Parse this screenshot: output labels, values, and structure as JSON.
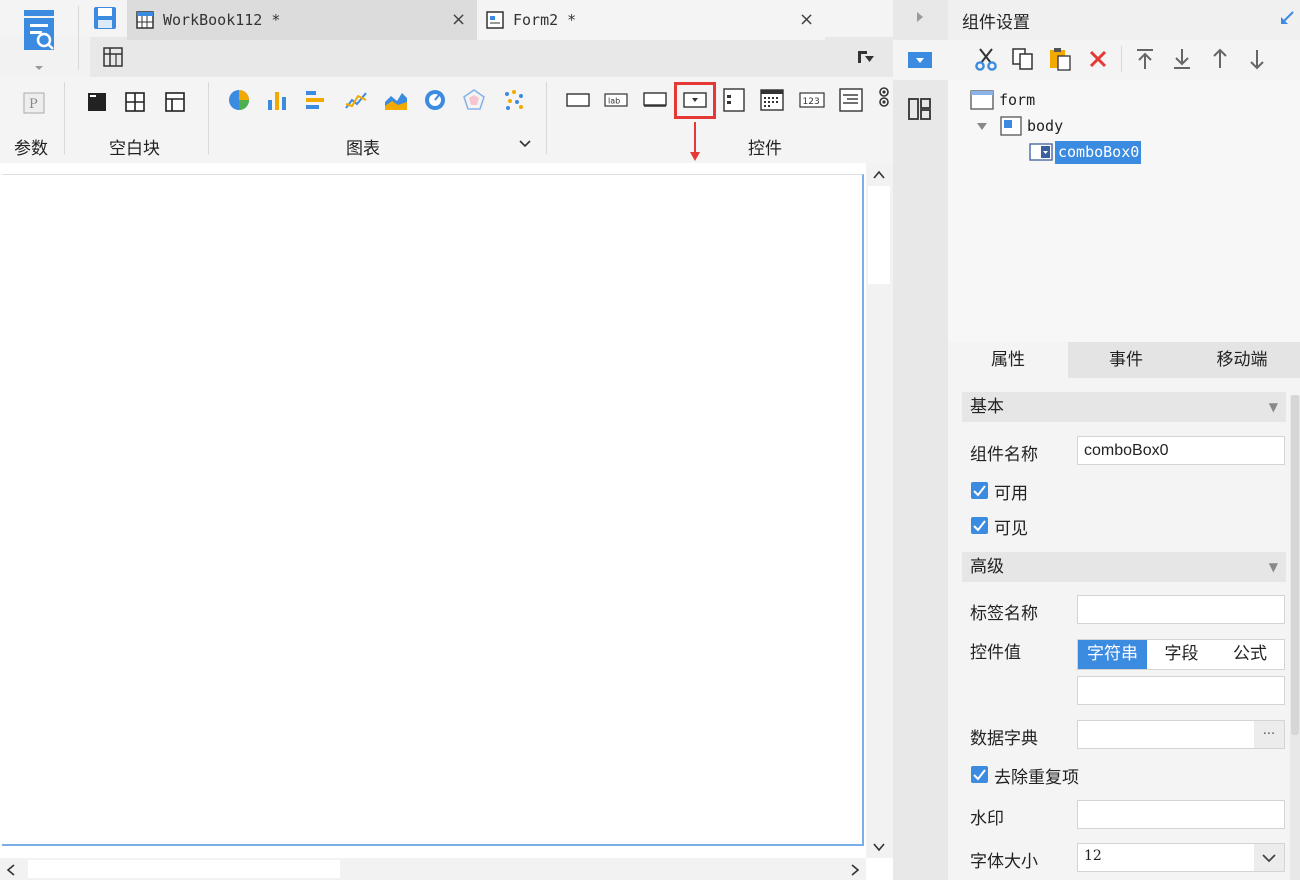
{
  "tabs": [
    {
      "label": "WorkBook112 *",
      "close": "×",
      "icon": "workbook-grid-icon"
    },
    {
      "label": "Form2 *",
      "close": "×",
      "icon": "form-icon"
    }
  ],
  "ribbon": {
    "param_label": "参数",
    "blank_label": "空白块",
    "chart_label": "图表",
    "widget_label": "控件"
  },
  "panel": {
    "title": "组件设置",
    "tree": {
      "form": "form",
      "body": "body",
      "combo": "comboBox0"
    },
    "tabs": [
      "属性",
      "事件",
      "移动端"
    ],
    "sections": {
      "basic": "基本",
      "advanced": "高级"
    },
    "props": {
      "name_label": "组件名称",
      "name_value": "comboBox0",
      "enabled_label": "可用",
      "visible_label": "可见",
      "tag_label": "标签名称",
      "tag_value": "",
      "value_label": "控件值",
      "value_modes": [
        "字符串",
        "字段",
        "公式"
      ],
      "value_text": "",
      "dict_label": "数据字典",
      "dict_btn": "···",
      "dedupe_label": "去除重复项",
      "watermark_label": "水印",
      "watermark_value": "",
      "fontsize_label": "字体大小",
      "fontsize_value": "12"
    }
  },
  "colors": {
    "accent": "#3b8be0",
    "highlight": "#e53935"
  }
}
